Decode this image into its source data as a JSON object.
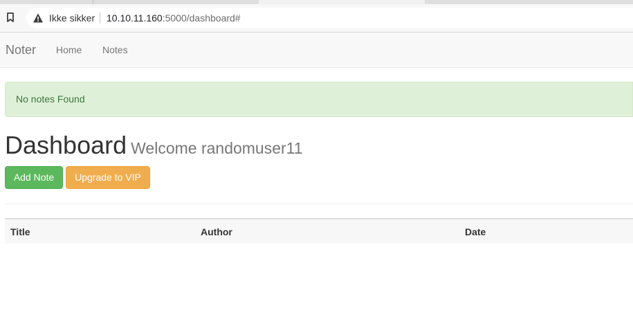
{
  "browser": {
    "security_label": "Ikke sikker",
    "url_host": "10.10.11.160",
    "url_rest": ":5000/dashboard#"
  },
  "navbar": {
    "brand": "Noter",
    "links": [
      {
        "label": "Home"
      },
      {
        "label": "Notes"
      }
    ]
  },
  "alert": {
    "message": "No notes Found",
    "color": "#dff0d8"
  },
  "header": {
    "title": "Dashboard",
    "welcome": "Welcome randomuser11"
  },
  "actions": {
    "add_note": "Add Note",
    "upgrade": "Upgrade to VIP",
    "success_color": "#5cb85c",
    "warning_color": "#f0ad4e"
  },
  "table": {
    "columns": [
      "Title",
      "Author",
      "Date"
    ],
    "rows": []
  }
}
